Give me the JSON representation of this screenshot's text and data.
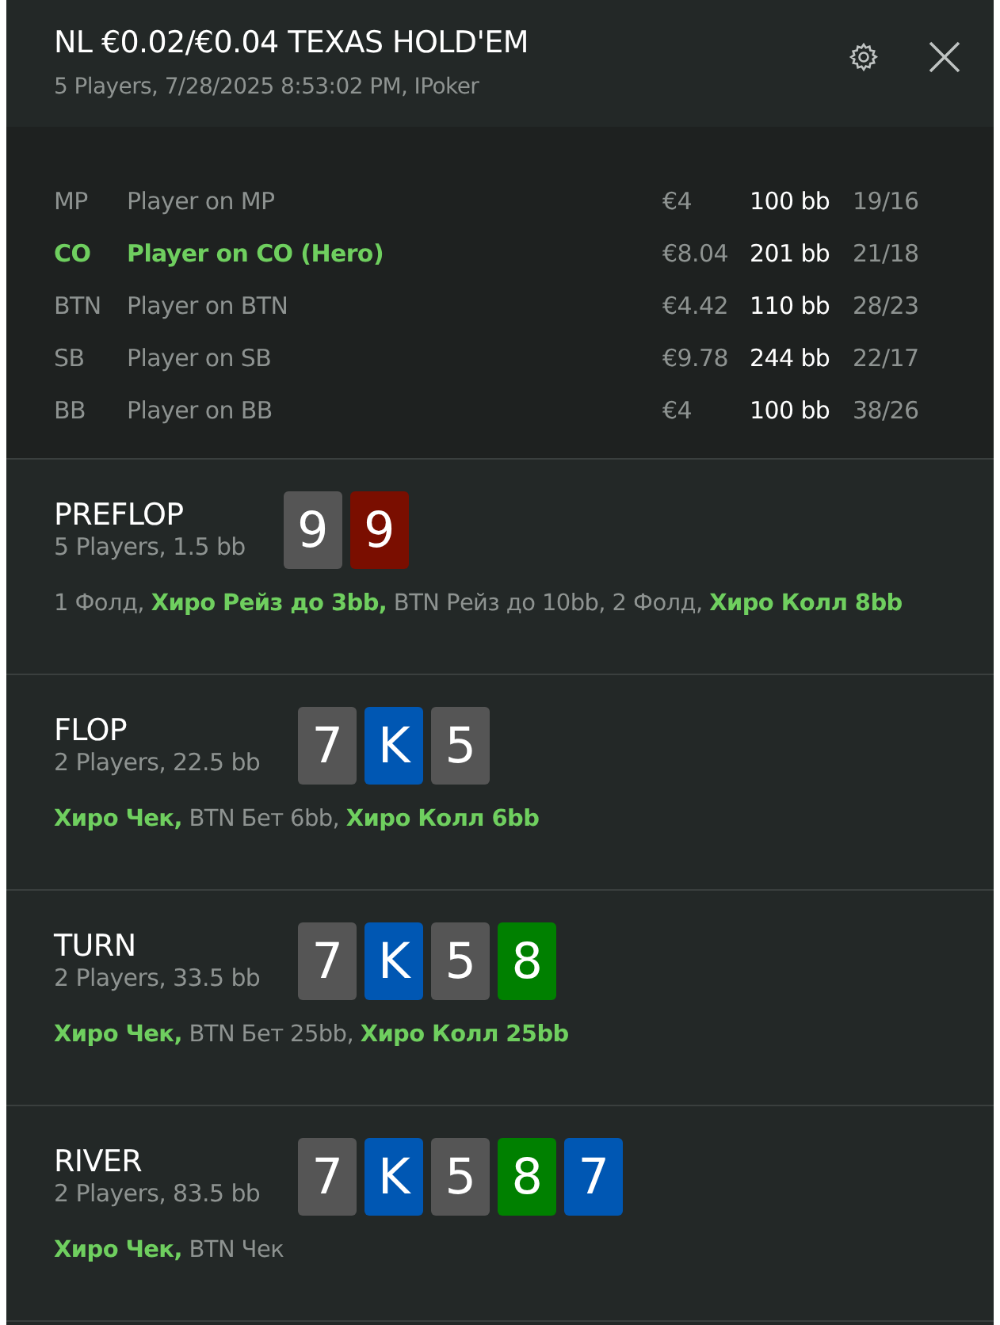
{
  "header": {
    "title": "NL €0.02/€0.04 TEXAS HOLD'EM",
    "subtitle": "5 Players, 7/28/2025 8:53:02 PM, IPoker"
  },
  "players": [
    {
      "position": "MP",
      "name": "Player on MP",
      "stack": "€4",
      "stack_bb": "100 bb",
      "stats": "19/16",
      "hero": false
    },
    {
      "position": "CO",
      "name": "Player on CO (Hero)",
      "stack": "€8.04",
      "stack_bb": "201 bb",
      "stats": "21/18",
      "hero": true
    },
    {
      "position": "BTN",
      "name": "Player on BTN",
      "stack": "€4.42",
      "stack_bb": "110 bb",
      "stats": "28/23",
      "hero": false
    },
    {
      "position": "SB",
      "name": "Player on SB",
      "stack": "€9.78",
      "stack_bb": "244 bb",
      "stats": "22/17",
      "hero": false
    },
    {
      "position": "BB",
      "name": "Player on BB",
      "stack": "€4",
      "stack_bb": "100 bb",
      "stats": "38/26",
      "hero": false
    }
  ],
  "streets": [
    {
      "name": "PREFLOP",
      "info": "5 Players, 1.5 bb",
      "cards": [
        {
          "rank": "9",
          "color": "#555555"
        },
        {
          "rank": "9",
          "color": "#7a0e00"
        }
      ],
      "actions": "1 Фолд, **Хиро Рейз до 3bb,** BTN Рейз до 10bb, 2 Фолд, **Хиро Колл 8bb**"
    },
    {
      "name": "FLOP",
      "info": "2 Players, 22.5 bb",
      "cards": [
        {
          "rank": "7",
          "color": "#555555"
        },
        {
          "rank": "K",
          "color": "#0057b3"
        },
        {
          "rank": "5",
          "color": "#555555"
        }
      ],
      "actions": "**Хиро Чек,** BTN Бет 6bb, **Хиро Колл 6bb**"
    },
    {
      "name": "TURN",
      "info": "2 Players, 33.5 bb",
      "cards": [
        {
          "rank": "7",
          "color": "#555555"
        },
        {
          "rank": "K",
          "color": "#0057b3"
        },
        {
          "rank": "5",
          "color": "#555555"
        },
        {
          "rank": "8",
          "color": "#008000"
        }
      ],
      "actions": "**Хиро Чек,** BTN Бет 25bb, **Хиро Колл 25bb**"
    },
    {
      "name": "RIVER",
      "info": "2 Players, 83.5 bb",
      "cards": [
        {
          "rank": "7",
          "color": "#555555"
        },
        {
          "rank": "K",
          "color": "#0057b3"
        },
        {
          "rank": "5",
          "color": "#555555"
        },
        {
          "rank": "8",
          "color": "#008000"
        },
        {
          "rank": "7",
          "color": "#0057b3"
        }
      ],
      "actions": "**Хиро Чек,** BTN Чек"
    }
  ]
}
